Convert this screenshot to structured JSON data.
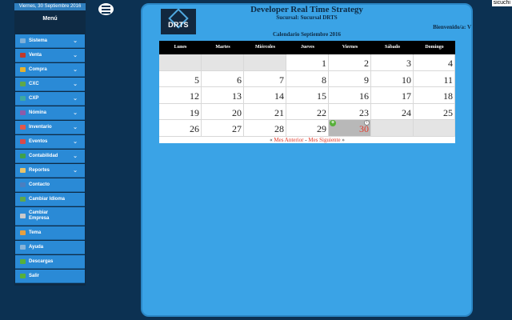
{
  "user": "sicuchi",
  "sidebar": {
    "date": "Viernes, 30 Septiembre 2016",
    "title": "Menú",
    "items": [
      {
        "label": "Sistema",
        "icon": "computer-icon",
        "color": "#7fb0d8",
        "expandable": true
      },
      {
        "label": "Venta",
        "icon": "cash-register-icon",
        "color": "#c0392b",
        "expandable": true
      },
      {
        "label": "Compra",
        "icon": "cart-icon",
        "color": "#e6b12e",
        "expandable": true
      },
      {
        "label": "CXC",
        "icon": "receivable-icon",
        "color": "#5fa84a",
        "expandable": true
      },
      {
        "label": "CXP",
        "icon": "payable-icon",
        "color": "#3fa9a0",
        "expandable": true
      },
      {
        "label": "Nómina",
        "icon": "payroll-icon",
        "color": "#8e5aa8",
        "expandable": true
      },
      {
        "label": "Inventario",
        "icon": "inventory-icon",
        "color": "#e2584a",
        "expandable": true
      },
      {
        "label": "Eventos",
        "icon": "calendar-icon",
        "color": "#d94a4a",
        "expandable": true
      },
      {
        "label": "Contabilidad",
        "icon": "ledger-icon",
        "color": "#3fa14a",
        "expandable": true
      },
      {
        "label": "Reportes",
        "icon": "report-icon",
        "color": "#e9c46a",
        "expandable": true
      },
      {
        "label": "Contacto",
        "icon": "contact-icon",
        "color": "#4a7fc0",
        "expandable": false
      },
      {
        "label": "Cambiar Idioma",
        "icon": "language-icon",
        "color": "#5fa84a",
        "expandable": false
      },
      {
        "label": "Cambiar Empresa",
        "icon": "building-icon",
        "color": "#c9c9c9",
        "expandable": false
      },
      {
        "label": "Tema",
        "icon": "theme-icon",
        "color": "#e6a040",
        "expandable": false
      },
      {
        "label": "Ayuda",
        "icon": "help-icon",
        "color": "#8ab4d8",
        "expandable": false
      },
      {
        "label": "Descargas",
        "icon": "download-icon",
        "color": "#57b03a",
        "expandable": false
      },
      {
        "label": "Salir",
        "icon": "exit-icon",
        "color": "#57b03a",
        "expandable": false
      }
    ]
  },
  "header": {
    "logo_text": "DRTS",
    "company": "Developer Real Time Strategy",
    "branch": "Sucursal: Sucursal DRTS",
    "welcome": "Bienvenido/a: V",
    "calendar_title": "Calendario Septiembre 2016"
  },
  "calendar": {
    "weekdays": [
      "Lunes",
      "Martes",
      "Miércoles",
      "Jueves",
      "Viernes",
      "Sábado",
      "Domingo"
    ],
    "weeks": [
      [
        "",
        "",
        "",
        "1",
        "2",
        "3",
        "4"
      ],
      [
        "5",
        "6",
        "7",
        "8",
        "9",
        "10",
        "11"
      ],
      [
        "12",
        "13",
        "14",
        "15",
        "16",
        "17",
        "18"
      ],
      [
        "19",
        "20",
        "21",
        "22",
        "23",
        "24",
        "25"
      ],
      [
        "26",
        "27",
        "28",
        "29",
        "30",
        "",
        ""
      ]
    ],
    "today": "30",
    "nav_prefix": "« ",
    "prev_label": "Mes Anterior",
    "separator": " - ",
    "next_label": "Mes Siguiente",
    "nav_suffix": " »"
  },
  "colors": {
    "background": "#0c3152",
    "panel": "#3aa3e6",
    "menu_item": "#2a8ad6",
    "today_text": "#e23a2c"
  }
}
